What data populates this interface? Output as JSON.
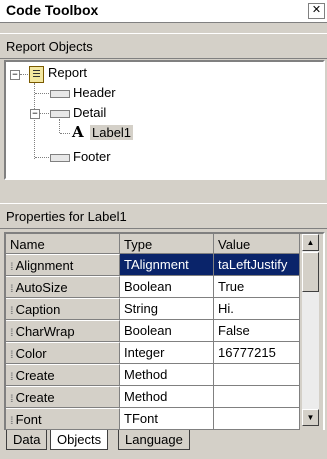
{
  "window": {
    "title": "Code Toolbox",
    "close_glyph": "✕"
  },
  "tree_section": {
    "label": "Report Objects"
  },
  "tree": {
    "root": {
      "label": "Report",
      "expander": "−"
    },
    "header": {
      "label": "Header"
    },
    "detail": {
      "label": "Detail",
      "expander": "−"
    },
    "label1": {
      "label": "Label1",
      "glyph": "A"
    },
    "footer": {
      "label": "Footer"
    }
  },
  "props_section": {
    "label": "Properties for Label1"
  },
  "grid": {
    "columns": [
      "Name",
      "Type",
      "Value"
    ],
    "rows": [
      {
        "name": "Alignment",
        "type": "TAlignment",
        "value": "taLeftJustify",
        "selected": true
      },
      {
        "name": "AutoSize",
        "type": "Boolean",
        "value": "True"
      },
      {
        "name": "Caption",
        "type": "String",
        "value": "Hi."
      },
      {
        "name": "CharWrap",
        "type": "Boolean",
        "value": "False"
      },
      {
        "name": "Color",
        "type": "Integer",
        "value": "16777215"
      },
      {
        "name": "Create",
        "type": "Method",
        "value": ""
      },
      {
        "name": "Create",
        "type": "Method",
        "value": ""
      },
      {
        "name": "Font",
        "type": "TFont",
        "value": ""
      }
    ]
  },
  "tabs": [
    {
      "label": "Data",
      "active": false
    },
    {
      "label": "Objects",
      "active": true
    },
    {
      "label": "Language",
      "active": false
    }
  ],
  "colors": {
    "selection": "#0a246a",
    "face": "#d4d0c8"
  }
}
